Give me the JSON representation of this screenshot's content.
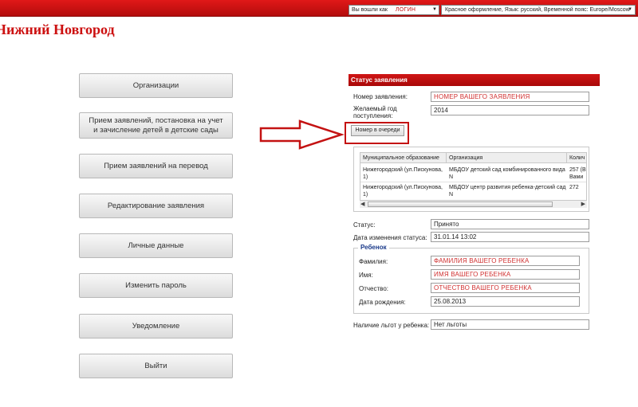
{
  "topbar": {
    "user_label": "Вы вошли как",
    "user_login": "ЛОГИН",
    "user_dropdown_icon": "chevron-down-icon",
    "settings_label": "Красное оформление, Язык: русский, Временной пояс: Europe/Moscow"
  },
  "city_title": "Нижний Новгород",
  "menu": [
    {
      "label": "Организации"
    },
    {
      "label": "Прием заявлений, постановка на учет и зачисление детей в детские сады"
    },
    {
      "label": "Прием заявлений на перевод"
    },
    {
      "label": "Редактирование заявления"
    },
    {
      "label": "Личные данные"
    },
    {
      "label": "Изменить пароль"
    },
    {
      "label": "Уведомление"
    },
    {
      "label": "Выйти"
    }
  ],
  "status_panel": {
    "header": "Статус заявления",
    "app_number_label": "Номер заявления:",
    "app_number_value": "НОМЕР ВАШЕГО ЗАЯВЛЕНИЯ",
    "year_label_1": "Желаемый год",
    "year_label_2": "поступления:",
    "year_value": "2014",
    "queue_button": "Номер в очереди",
    "grid": {
      "columns": [
        "Муниципальное образование",
        "Организация",
        "Колич"
      ],
      "rows": [
        {
          "municipality_1": "Нижегородский (ул.Пискунова,",
          "municipality_2": "1)",
          "org_1": "МБДОУ детский сад комбинированного вида",
          "org_2": "N",
          "count_1": "257 (В",
          "count_2": "Вами"
        },
        {
          "municipality_1": "Нижегородский (ул.Пискунова,",
          "municipality_2": "1)",
          "org_1": "МБДОУ центр развития ребенка-детский сад",
          "org_2": "N",
          "count_1": "272",
          "count_2": ""
        }
      ]
    },
    "status_label": "Статус:",
    "status_value": "Принято",
    "status_date_label": "Дата изменения статуса:",
    "status_date_value": "31.01.14 13:02",
    "child": {
      "legend": "Ребенок",
      "surname_label": "Фамилия:",
      "surname_value": "ФАМИЛИЯ ВАШЕГО РЕБЕНКА",
      "name_label": "Имя:",
      "name_value": "ИМЯ ВАШЕГО РЕБЕНКА",
      "patronymic_label": "Отчество:",
      "patronymic_value": "ОТЧЕСТВО ВАШЕГО РЕБЕНКА",
      "birthdate_label": "Дата рождения:",
      "birthdate_value": "25.08.2013"
    },
    "benefits_label": "Наличие льгот у ребенка:",
    "benefits_value": "Нет льготы"
  },
  "colors": {
    "brand_red": "#cc1010",
    "highlight_red": "#c41212"
  }
}
